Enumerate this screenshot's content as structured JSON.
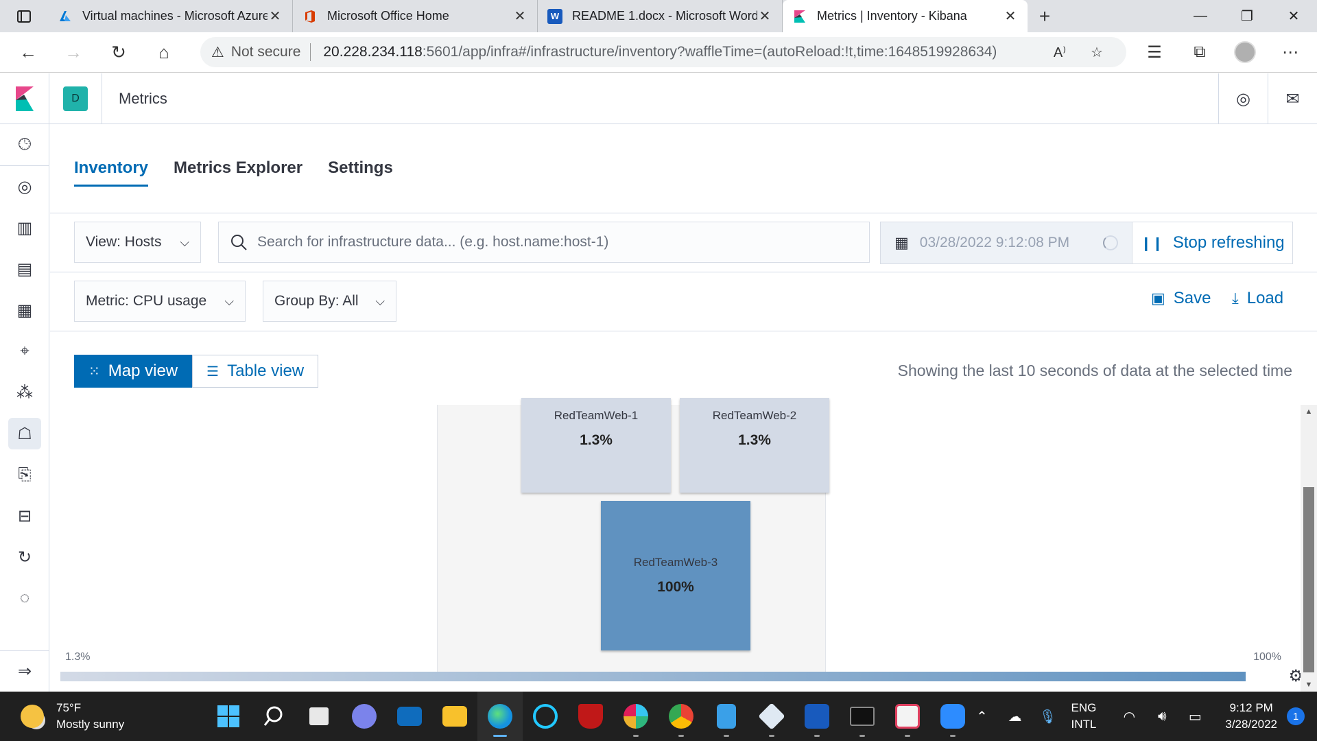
{
  "browser": {
    "tabs": [
      {
        "title": "Virtual machines - Microsoft Azure",
        "favicon": "azure-icon",
        "color": "#0078d4"
      },
      {
        "title": "Microsoft Office Home",
        "favicon": "office-icon",
        "color": "#d83b01"
      },
      {
        "title": "README 1.docx - Microsoft Word",
        "favicon": "word-icon",
        "color": "#185abd"
      },
      {
        "title": "Metrics | Inventory - Kibana",
        "favicon": "kibana-icon",
        "color": "#e7478b",
        "active": true
      }
    ],
    "address": {
      "security": "Not secure",
      "host": "20.228.234.118",
      "path": ":5601/app/infra#/infrastructure/inventory?waffleTime=(autoReload:!t,time:1648519928634)"
    }
  },
  "kibana": {
    "space_badge": "D",
    "breadcrumb": "Metrics",
    "subnav": [
      "Inventory",
      "Metrics Explorer",
      "Settings"
    ],
    "view_select": "View: Hosts",
    "search_placeholder": "Search for infrastructure data... (e.g. host.name:host-1)",
    "date": "03/28/2022 9:12:08 PM",
    "stop_refreshing": "Stop refreshing",
    "metric_select": "Metric: CPU usage",
    "group_by_select": "Group By: All",
    "save_label": "Save",
    "load_label": "Load",
    "map_view_label": "Map view",
    "table_view_label": "Table view",
    "showing_text": "Showing the last 10 seconds of data at the selected time",
    "nodes": [
      {
        "name": "RedTeamWeb-1",
        "value": "1.3%",
        "color": "#d3dae6"
      },
      {
        "name": "RedTeamWeb-2",
        "value": "1.3%",
        "color": "#d3dae6"
      },
      {
        "name": "RedTeamWeb-3",
        "value": "100%",
        "color": "#6092c0"
      }
    ],
    "legend": {
      "min": "1.3%",
      "max": "100%",
      "low_color": "#d3dae6",
      "high_color": "#6092c0"
    }
  },
  "taskbar": {
    "weather_temp": "75°F",
    "weather_desc": "Mostly sunny",
    "lang1": "ENG",
    "lang2": "INTL",
    "time": "9:12 PM",
    "date": "3/28/2022",
    "notifications": "1"
  }
}
